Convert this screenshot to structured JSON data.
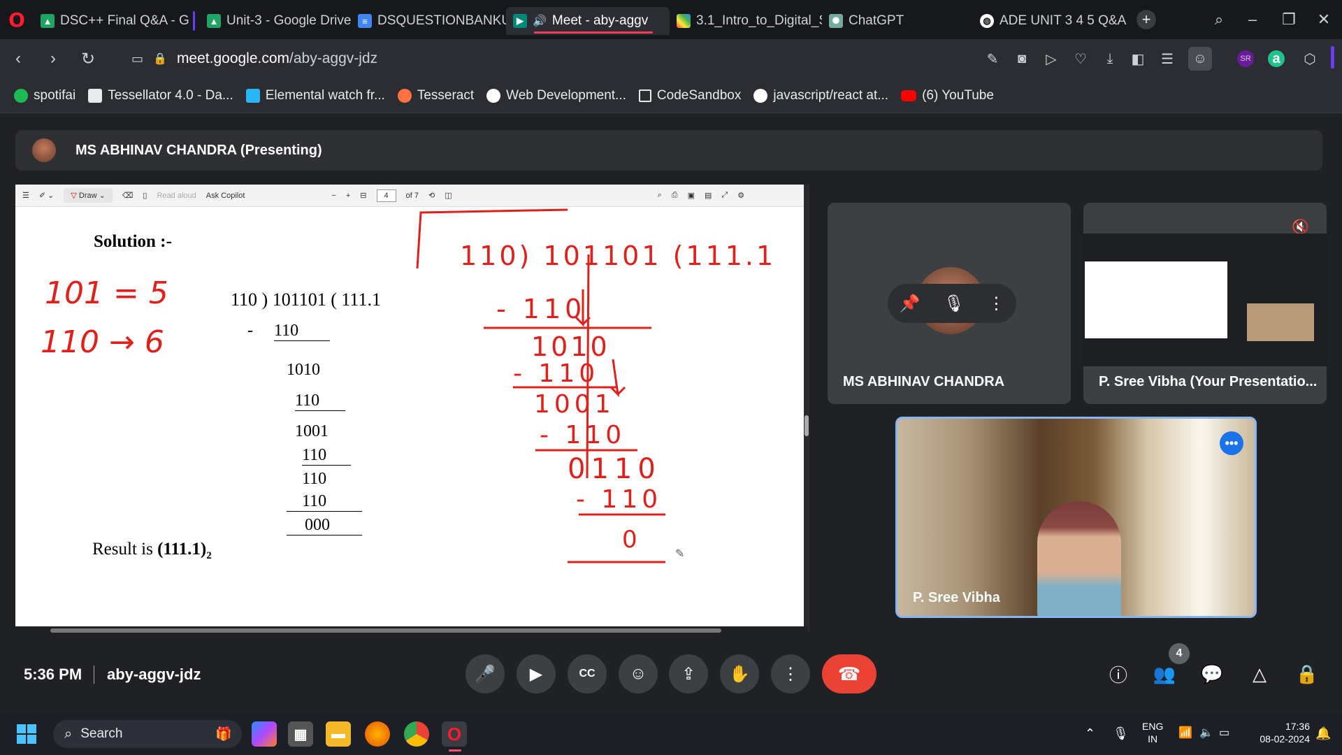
{
  "browser": {
    "tabs": [
      {
        "title": "DSC++ Final Q&A - G",
        "icon": "google-drive-icon"
      },
      {
        "title": "Unit-3 - Google Drive",
        "icon": "google-drive-icon"
      },
      {
        "title": "DSQUESTIONBANKUN",
        "icon": "google-docs-icon"
      },
      {
        "title": "Meet - aby-aggv",
        "icon": "google-meet-icon"
      },
      {
        "title": "3.1_Intro_to_Digital_Sy",
        "icon": "colorful-grid-icon"
      },
      {
        "title": "ChatGPT",
        "icon": "chatgpt-icon"
      },
      {
        "title": "ADE UNIT 3 4 5 Q&A",
        "icon": "globe-icon"
      }
    ],
    "new_tab": "+",
    "url_host": "meet.google.com",
    "url_path": "/aby-aggv-jdz",
    "bookmarks": [
      {
        "label": "spotifai",
        "color": "#1db954"
      },
      {
        "label": "Tessellator 4.0 - Da...",
        "color": "#e8eaed"
      },
      {
        "label": "Elemental watch fr...",
        "color": "#29b6f6"
      },
      {
        "label": "Tesseract",
        "color": "#ff7043"
      },
      {
        "label": "Web Development...",
        "color": "#ffffff"
      },
      {
        "label": "CodeSandbox",
        "color": "#e8eaed"
      },
      {
        "label": "javascript/react at...",
        "color": "#ffffff"
      },
      {
        "label": "(6) YouTube",
        "color": "#ff0000"
      }
    ]
  },
  "meet": {
    "presenter_bar": "MS ABHINAV CHANDRA (Presenting)",
    "pdf_toolbar": {
      "draw": "Draw",
      "read_aloud": "Read aloud",
      "ask_copilot": "Ask Copilot",
      "page": "4",
      "of_pages": "of 7"
    },
    "slide": {
      "heading": "Solution :-",
      "division_line": "110 ) 101101 ( 111.1",
      "minus": "-",
      "rows": [
        "110",
        "1010",
        "110",
        "1001",
        "110",
        "110",
        "110",
        "000"
      ],
      "result_prefix": "Result is ",
      "result_value": "(111.1)",
      "result_sub": "2",
      "annotations_left": [
        "101 = 5",
        "110 → 6"
      ],
      "annotations_right": [
        "110) 101101 (111.1",
        "- 110",
        "1010",
        "- 110",
        "1001",
        "- 110",
        "0110",
        "- 110",
        "0"
      ]
    },
    "tiles": {
      "abhinav": "MS ABHINAV CHANDRA",
      "presentation": "P. Sree Vibha (Your Presentatio...",
      "self": "P. Sree Vibha"
    },
    "time": "5:36 PM",
    "meeting_code": "aby-aggv-jdz",
    "participants_count": "4"
  },
  "taskbar": {
    "search_label": "Search",
    "lang_top": "ENG",
    "lang_bottom": "IN",
    "clock_time": "17:36",
    "clock_date": "08-02-2024"
  }
}
